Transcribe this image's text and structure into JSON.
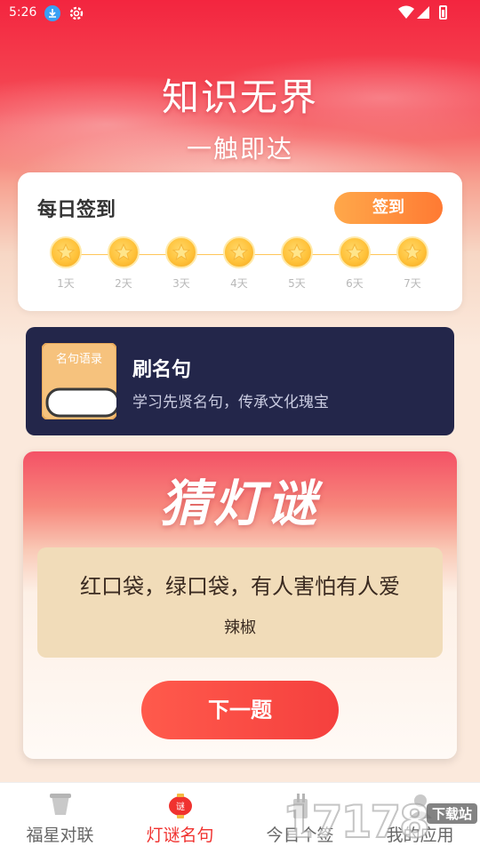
{
  "status": {
    "time": "5:26"
  },
  "hero": {
    "title": "知识无界",
    "subtitle": "一触即达"
  },
  "checkin": {
    "title": "每日签到",
    "button": "签到",
    "days": [
      "1天",
      "2天",
      "3天",
      "4天",
      "5天",
      "6天",
      "7天"
    ]
  },
  "quotes": {
    "book_label": "名句语录",
    "title": "刷名句",
    "desc": "学习先贤名句，传承文化瑰宝"
  },
  "riddle": {
    "logo": "猜灯谜",
    "question": "红口袋，绿口袋，有人害怕有人爱",
    "answer": "辣椒",
    "next_button": "下一题"
  },
  "tabs": [
    {
      "label": "福星对联",
      "icon": "scroll-icon"
    },
    {
      "label": "灯谜名句",
      "icon": "lantern-icon",
      "badge": "谜"
    },
    {
      "label": "今日个签",
      "icon": "lot-icon"
    },
    {
      "label": "我的应用",
      "icon": "profile-icon"
    }
  ],
  "watermark": {
    "number": "17178",
    "tag": "下载站"
  },
  "colors": {
    "accent": "#f0322f",
    "checkin_button": "#ff8f3e",
    "quote_card": "#23264a",
    "riddle_box": "#f1dcb9"
  }
}
